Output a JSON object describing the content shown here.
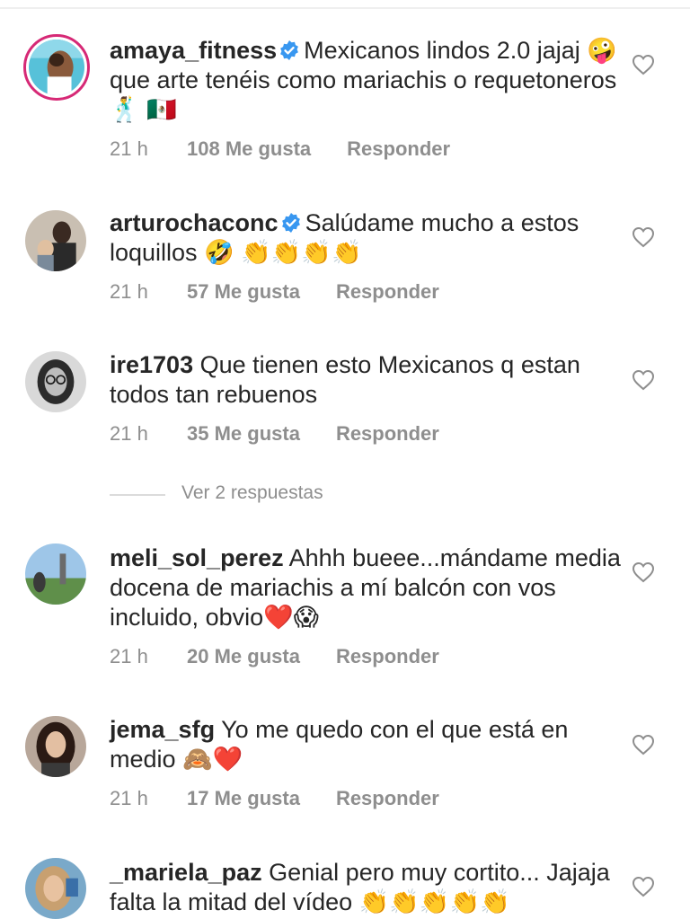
{
  "comments": [
    {
      "username": "amaya_fitness",
      "verified": true,
      "text": "Mexicanos lindos 2.0 jajaj 🤪 que arte tenéis como mariachis o requetoneros 🕺 🇲🇽",
      "time": "21 h",
      "likes": "108 Me gusta",
      "reply": "Responder",
      "avatar_icon": "avatar-beach-photo",
      "story_ring": true
    },
    {
      "username": "arturochaconc",
      "verified": true,
      "text": "Salúdame mucho a estos loquillos 🤣 👏👏👏👏",
      "time": "21 h",
      "likes": "57 Me gusta",
      "reply": "Responder",
      "avatar_icon": "avatar-man-with-child"
    },
    {
      "username": "ire1703",
      "verified": false,
      "text": "Que tienen esto Mexicanos q estan todos tan rebuenos",
      "time": "21 h",
      "likes": "35 Me gusta",
      "reply": "Responder",
      "avatar_icon": "avatar-woman-glasses-bw",
      "view_replies": "Ver 2 respuestas"
    },
    {
      "username": "meli_sol_perez",
      "verified": false,
      "text": "Ahhh bueee...mándame media docena de mariachis a mí balcón con vos incluido, obvio❤️😱",
      "time": "21 h",
      "likes": "20 Me gusta",
      "reply": "Responder",
      "avatar_icon": "avatar-park-outdoor"
    },
    {
      "username": "jema_sfg",
      "verified": false,
      "text": "Yo me quedo con el que está en medio 🙈❤️",
      "time": "21 h",
      "likes": "17 Me gusta",
      "reply": "Responder",
      "avatar_icon": "avatar-woman-dark-hair"
    },
    {
      "username": "_mariela_paz",
      "verified": false,
      "text": "Genial pero muy cortito... Jajaja falta la mitad del vídeo 👏👏👏👏👏",
      "avatar_icon": "avatar-woman-blonde"
    }
  ],
  "colors": {
    "verified": "#3897f0",
    "muted": "#8e8e8e",
    "text": "#262626",
    "story_ring": "#d62976"
  },
  "icons": {
    "like": "heart-outline-icon",
    "verified": "verified-badge-icon"
  }
}
